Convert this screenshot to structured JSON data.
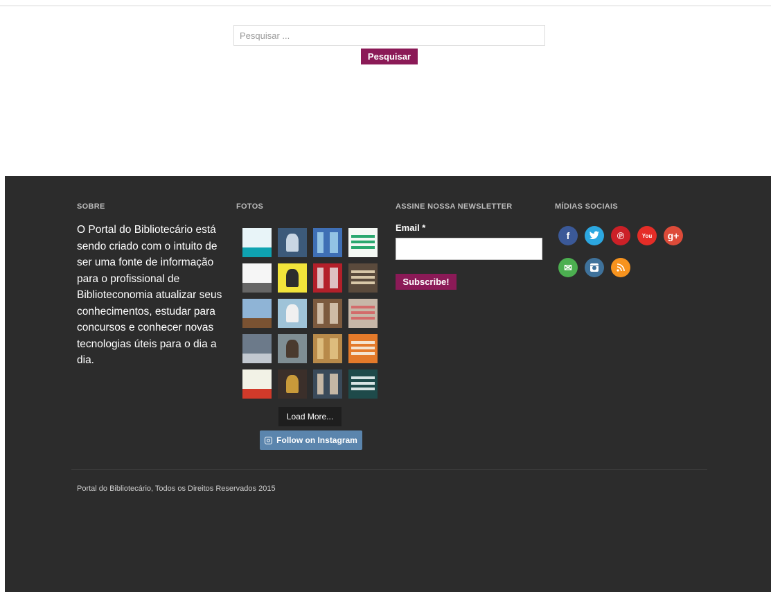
{
  "search": {
    "placeholder": "Pesquisar ...",
    "button_label": "Pesquisar"
  },
  "footer": {
    "about": {
      "title": "SOBRE",
      "text": "O Portal do Bibliotecário está sendo criado com o intuito de ser uma fonte de informação para o profissional de Biblioteconomia atualizar seus conhecimentos, estudar para concursos e conhecer novas tecnologias úteis para o dia a dia."
    },
    "photos": {
      "title": "FOTOS",
      "load_more_label": "Load More...",
      "follow_label": "Follow on Instagram",
      "thumbnails": [
        {
          "name": "photo-1",
          "bg": "#e8f4f8",
          "accent": "#0fa3b1"
        },
        {
          "name": "photo-2",
          "bg": "#3c5a7a",
          "accent": "#c9d6e3"
        },
        {
          "name": "photo-3",
          "bg": "#3f6fb5",
          "accent": "#a8d8f0"
        },
        {
          "name": "photo-4",
          "bg": "#f4f8f4",
          "accent": "#2aa86f"
        },
        {
          "name": "photo-5",
          "bg": "#f6f6f6",
          "accent": "#666666"
        },
        {
          "name": "photo-6",
          "bg": "#f2e43a",
          "accent": "#2d2d2d"
        },
        {
          "name": "photo-7",
          "bg": "#b3202a",
          "accent": "#e8e8e8"
        },
        {
          "name": "photo-8",
          "bg": "#5a4a3c",
          "accent": "#d8c7a8"
        },
        {
          "name": "photo-9",
          "bg": "#8fb4d6",
          "accent": "#7a5232"
        },
        {
          "name": "photo-10",
          "bg": "#9fc3d8",
          "accent": "#f0f0f0"
        },
        {
          "name": "photo-11",
          "bg": "#7c5a3e",
          "accent": "#e4d5c0"
        },
        {
          "name": "photo-12",
          "bg": "#c7b7a8",
          "accent": "#d36b6b"
        },
        {
          "name": "photo-13",
          "bg": "#6c7a8a",
          "accent": "#c2c8d0"
        },
        {
          "name": "photo-14",
          "bg": "#7f8e94",
          "accent": "#4a3a2f"
        },
        {
          "name": "photo-15",
          "bg": "#b88a4a",
          "accent": "#e6c98a"
        },
        {
          "name": "photo-16",
          "bg": "#e47a2a",
          "accent": "#f4e4d0"
        },
        {
          "name": "photo-17",
          "bg": "#f2f2e6",
          "accent": "#d13a2a"
        },
        {
          "name": "photo-18",
          "bg": "#3b2f2a",
          "accent": "#c99a3a"
        },
        {
          "name": "photo-19",
          "bg": "#3a4a5a",
          "accent": "#e8d2b8"
        },
        {
          "name": "photo-20",
          "bg": "#1e4a4a",
          "accent": "#d8e4e4"
        }
      ]
    },
    "newsletter": {
      "title": "ASSINE NOSSA NEWSLETTER",
      "email_label": "Email *",
      "email_value": "",
      "subscribe_label": "Subscribe!"
    },
    "social": {
      "title": "MÍDIAS SOCIAIS",
      "icons": [
        {
          "name": "facebook-icon",
          "glyph": "f",
          "color": "#3b5998"
        },
        {
          "name": "twitter-icon",
          "glyph": "",
          "color": "#2ca7e0"
        },
        {
          "name": "pinterest-icon",
          "glyph": "℗",
          "color": "#cb2027"
        },
        {
          "name": "youtube-icon",
          "glyph": "You",
          "color": "#e52d27"
        },
        {
          "name": "google-plus-icon",
          "glyph": "g+",
          "color": "#dd4b39"
        },
        {
          "name": "email-icon",
          "glyph": "✉",
          "color": "#4caf50"
        },
        {
          "name": "instagram-icon",
          "glyph": "",
          "color": "#3f729b"
        },
        {
          "name": "rss-icon",
          "glyph": "",
          "color": "#f7931e"
        }
      ]
    },
    "copyright": "Portal do Bibliotecário, Todos os Direitos Reservados 2015"
  }
}
